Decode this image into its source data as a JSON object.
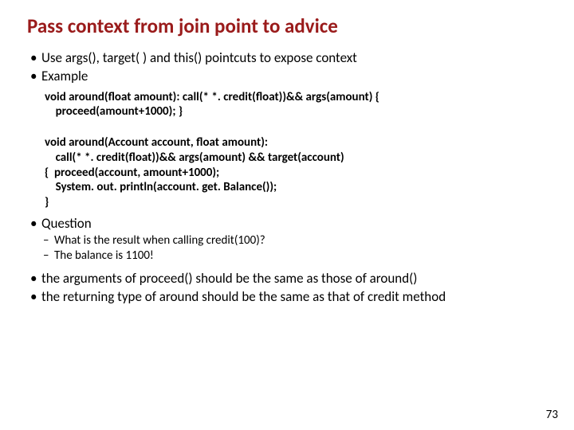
{
  "title": "Pass context from join point to advice",
  "bullets": {
    "b1": "Use args(), target( ) and this() pointcuts to expose context",
    "b2": "Example",
    "b3": "Question",
    "b4": "the arguments of proceed() should be the same as those of around()",
    "b5": "the returning type of around should be the same as that of credit method"
  },
  "code1": {
    "l1": "void around(float amount): call(* *. credit(float))&& args(amount) {",
    "l2": "    proceed(amount+1000); }"
  },
  "code2": {
    "l1": "void around(Account account, float amount):",
    "l2": "    call(* *. credit(float))&& args(amount) && target(account)",
    "l3": "{  proceed(account, amount+1000);",
    "l4": "    System. out. println(account. get. Balance());",
    "l5": "}"
  },
  "subs": {
    "s1": "What is the result when calling credit(100)?",
    "s2": "The balance is 1100!"
  },
  "page": "73"
}
